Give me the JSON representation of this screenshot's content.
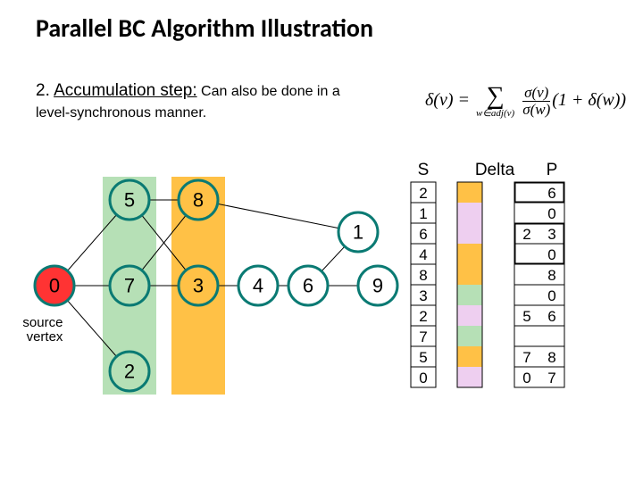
{
  "title": "Parallel BC Algorithm Illustration",
  "step_prefix": "2. ",
  "step_name": "Accumulation step:",
  "step_tail1": " Can also be done in a",
  "step_tail2": "level-synchronous manner.",
  "formula": {
    "lhs": "δ(v) =",
    "sum_sub": "w∈adj(v)",
    "frac_num": "σ(v)",
    "frac_den": "σ(w)",
    "tail": "(1 + δ(w))"
  },
  "headers": {
    "S": "S",
    "Delta": "Delta",
    "P": "P"
  },
  "source_label": "source\nvertex",
  "nodes": {
    "n0": "0",
    "n5": "5",
    "n7": "7",
    "n2": "2",
    "n8": "8",
    "n3": "3",
    "n4": "4",
    "n6": "6",
    "n1": "1",
    "n9": "9"
  },
  "S": [
    "2",
    "1",
    "6",
    "4",
    "8",
    "3",
    "2",
    "7",
    "5",
    "0"
  ],
  "P": [
    "6",
    "0",
    "2",
    "3",
    "0",
    "8",
    "0",
    "5",
    "6",
    "",
    "7",
    "8",
    "",
    "0",
    "7"
  ]
}
